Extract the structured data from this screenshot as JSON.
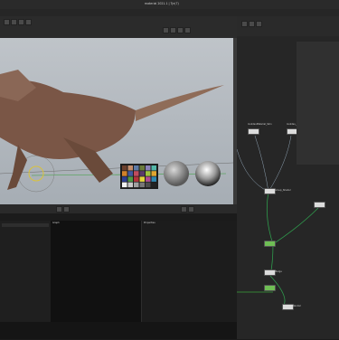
{
  "window": {
    "title": "material 2021.1 | Tyr(7)"
  },
  "left_tabs": {
    "graph": "Graph",
    "properties": "Properties"
  },
  "node_graph": {
    "nodes": [
      {
        "label": "lookdevMaterial_Skin"
      },
      {
        "label": "lookdev_Sphere"
      },
      {
        "label": "Group_Shader"
      },
      {
        "label": "Merge"
      },
      {
        "label": "Render"
      }
    ]
  },
  "chart_swatches": [
    "#6b3f2c",
    "#c28b6a",
    "#5e7aa5",
    "#6a7b3c",
    "#8a82b8",
    "#53b6a8",
    "#d1822b",
    "#4258a0",
    "#c04c5e",
    "#5b3a6b",
    "#9fc33e",
    "#e0a631",
    "#2d3f93",
    "#4e9a44",
    "#b3333a",
    "#e3d33b",
    "#b04c8f",
    "#2f88b1",
    "#f2f2f2",
    "#c8c8c8",
    "#a0a0a0",
    "#777777",
    "#4c4c4c",
    "#222222"
  ],
  "colors": {
    "accent": "#e0c040",
    "node_green": "#6fbf55",
    "link_green": "#2f9a4c"
  }
}
